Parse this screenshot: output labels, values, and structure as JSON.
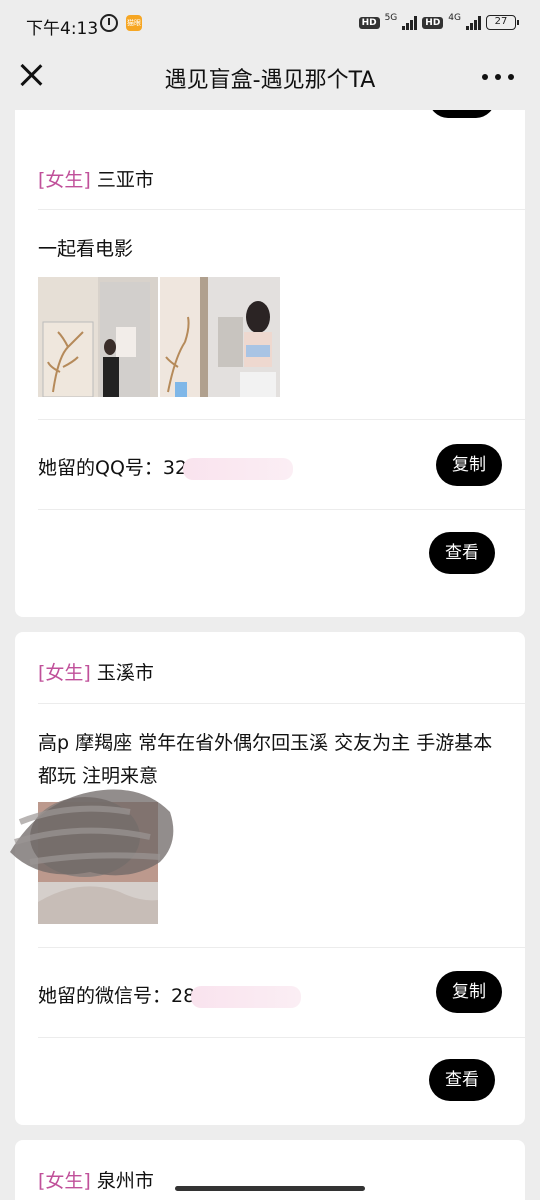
{
  "status": {
    "time": "下午4:13",
    "app_badge": "猫眼",
    "hd1": "HD",
    "net1": "5G",
    "hd2": "HD",
    "net2": "4G",
    "battery": "27"
  },
  "header": {
    "title": "遇见盲盒-遇见那个TA"
  },
  "cards": [
    {
      "gender": "[女生]",
      "city": "三亚市",
      "description": "一起看电影",
      "contact_label": "她留的QQ号：",
      "contact_value": "32",
      "copy_label": "复制",
      "view_label": "查看"
    },
    {
      "gender": "[女生]",
      "city": "玉溪市",
      "description": "高p 摩羯座 常年在省外偶尔回玉溪 交友为主 手游基本都玩 注明来意",
      "contact_label": "她留的微信号：",
      "contact_value": "28",
      "copy_label": "复制",
      "view_label": "查看"
    },
    {
      "gender": "[女生]",
      "city": "泉州市"
    }
  ]
}
